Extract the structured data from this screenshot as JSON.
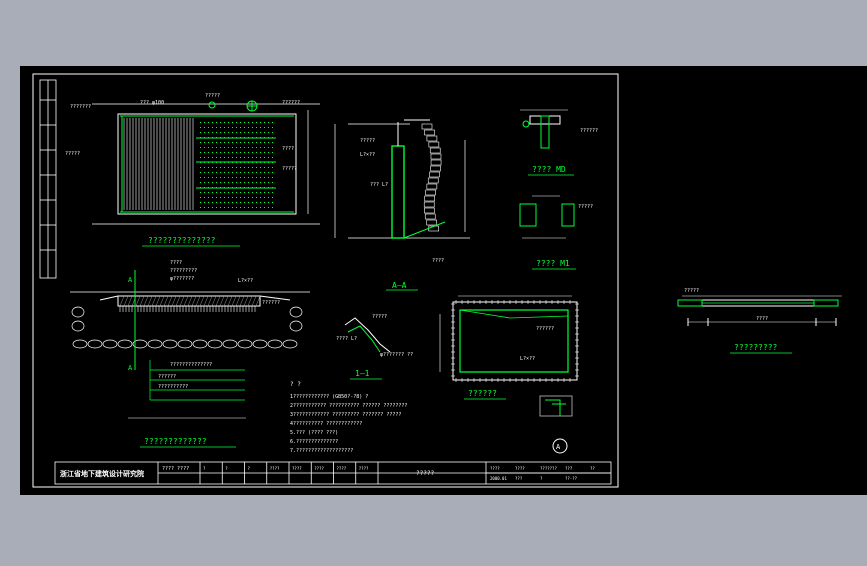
{
  "colors": {
    "app_background": "#a9adb8",
    "canvas": "#000000",
    "line_white": "#ffffff",
    "line_green": "#00ff33",
    "hatch_gray": "#9a9a9a"
  },
  "drawing": {
    "views": {
      "plan_title": "??????????????",
      "section_aa_title": "A—A",
      "md_title": "???? MD",
      "m1_title": "???? M1",
      "section_11_title": "1—1",
      "detail_a_marker": "A",
      "pool_title": "??????",
      "bottom_left_title": "?????????????",
      "side_title": "?????????"
    },
    "labels": {
      "l1": "???????",
      "l2": "??? φ100",
      "l3": "?????",
      "l4": "?????",
      "l5": "??????",
      "l6": "????",
      "l7": "?????",
      "l8": "?????",
      "l9": "L?×??",
      "l10": "??? L?",
      "l11": "????",
      "l12": "??????",
      "l13": "?????",
      "l14": "????",
      "l15": "?????????",
      "l16": "φ???????",
      "l17": "L?×??",
      "l18": "??????",
      "l19": "??????????????",
      "l20": "??????",
      "l21": "??????????",
      "l22": "???? L?",
      "l23": "?????",
      "l24": "φ??????? ??",
      "l25": "??????"
    },
    "notes": {
      "heading": "?  ?",
      "lines": [
        "1????????????    (GB50?-?8)         ?",
        "2???????????  ??????????   ??????   ????????",
        "3????????????  ?????????  ???????   ?????",
        "4??????????   ????????????",
        "5.??? (???? ???)",
        "6.??????????????",
        "7.???????????????????"
      ]
    },
    "title_block": {
      "org": "浙江省地下建筑设计研究院",
      "code": "????  ????",
      "cols": [
        "?",
        "?",
        "?",
        "????",
        "????",
        "????",
        "????",
        "????"
      ],
      "drawing_name": "?????",
      "right_labels": [
        "????",
        "????",
        "???????",
        "???",
        "??",
        "2000.01",
        "???",
        "?",
        "??-??"
      ]
    }
  }
}
